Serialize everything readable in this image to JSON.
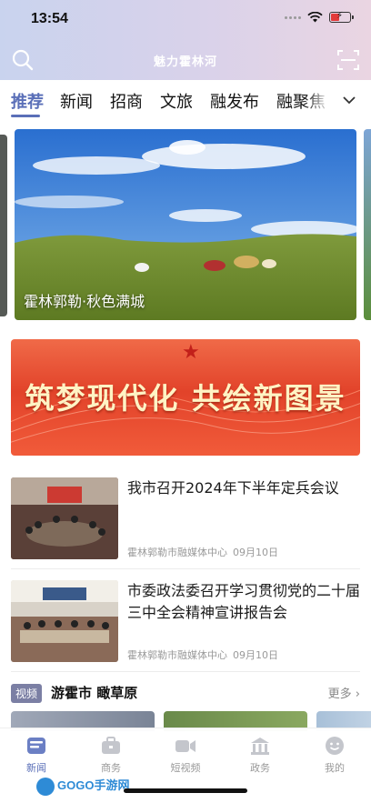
{
  "status_bar": {
    "time": "13:54"
  },
  "header": {
    "title": "魅力霍林河"
  },
  "tabs": [
    {
      "label": "推荐",
      "active": true
    },
    {
      "label": "新闻"
    },
    {
      "label": "招商"
    },
    {
      "label": "文旅"
    },
    {
      "label": "融发布"
    },
    {
      "label": "融聚焦"
    }
  ],
  "carousel": {
    "caption": "霍林郭勒·秋色满城"
  },
  "banner": {
    "text": "筑梦现代化 共绘新图景"
  },
  "news": [
    {
      "title": "我市召开2024年下半年定兵会议",
      "source": "霍林郭勒市融媒体中心",
      "date": "09月10日"
    },
    {
      "title": "市委政法委召开学习贯彻党的二十届三中全会精神宣讲报告会",
      "source": "霍林郭勒市融媒体中心",
      "date": "09月10日"
    }
  ],
  "video_section": {
    "badge": "视频",
    "title": "游霍市 瞰草原",
    "more": "更多"
  },
  "bottom_nav": [
    {
      "label": "新闻",
      "icon": "news-icon",
      "active": true
    },
    {
      "label": "商务",
      "icon": "briefcase-icon"
    },
    {
      "label": "短视频",
      "icon": "video-camera-icon"
    },
    {
      "label": "政务",
      "icon": "government-building-icon"
    },
    {
      "label": "我的",
      "icon": "smiley-face-icon"
    }
  ],
  "watermark": "GOGO手游网",
  "colors": {
    "accent": "#5a6fb8",
    "banner_red": "#e2432a",
    "battery_low": "#e23a3a"
  }
}
